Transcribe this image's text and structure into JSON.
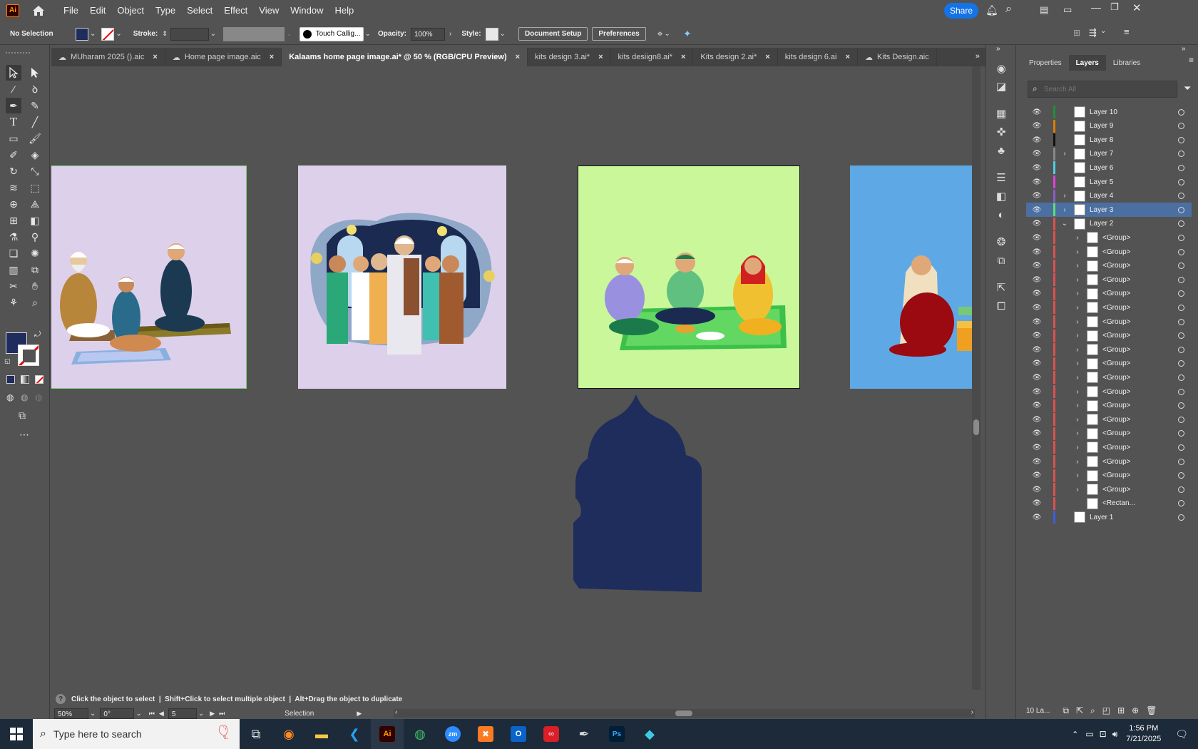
{
  "menubar": {
    "app_icon": "Ai",
    "items": [
      "File",
      "Edit",
      "Object",
      "Type",
      "Select",
      "Effect",
      "View",
      "Window",
      "Help"
    ],
    "share": "Share"
  },
  "control": {
    "selection": "No Selection",
    "stroke_label": "Stroke:",
    "brush": "Touch Callig...",
    "opacity_label": "Opacity:",
    "opacity": "100%",
    "style_label": "Style:",
    "doc_setup": "Document Setup",
    "preferences": "Preferences"
  },
  "tabs": [
    {
      "label": "MUharam 2025 ().aic",
      "close": "×",
      "cloud": true
    },
    {
      "label": "Home page image.aic",
      "close": "×",
      "cloud": true
    },
    {
      "label": "Kalaams home page image.ai* @ 50 % (RGB/CPU Preview)",
      "close": "×",
      "cloud": false
    },
    {
      "label": "kits design 3.ai*",
      "close": "×",
      "cloud": false
    },
    {
      "label": "kits desiign8.ai*",
      "close": "×",
      "cloud": false
    },
    {
      "label": "Kits design 2.ai*",
      "close": "×",
      "cloud": false
    },
    {
      "label": "kits design 6.ai",
      "close": "×",
      "cloud": false
    },
    {
      "label": "Kits Design.aic",
      "close": "",
      "cloud": true
    }
  ],
  "panel": {
    "tabs": [
      "Properties",
      "Layers",
      "Libraries"
    ],
    "search_placeholder": "Search All",
    "layers": [
      {
        "name": "Layer 10",
        "color": "#1f8f3a",
        "arrow": "",
        "indent": 0
      },
      {
        "name": "Layer 9",
        "color": "#e07b00",
        "arrow": "",
        "indent": 0
      },
      {
        "name": "Layer 8",
        "color": "#111111",
        "arrow": "",
        "indent": 0
      },
      {
        "name": "Layer 7",
        "color": "#888888",
        "arrow": "›",
        "indent": 0
      },
      {
        "name": "Layer 6",
        "color": "#4fd0e0",
        "arrow": "",
        "indent": 0
      },
      {
        "name": "Layer 5",
        "color": "#e040e0",
        "arrow": "",
        "indent": 0
      },
      {
        "name": "Layer 4",
        "color": "#8a5cc8",
        "arrow": "›",
        "indent": 0
      },
      {
        "name": "Layer 3",
        "color": "#5ee070",
        "arrow": "›",
        "indent": 0
      },
      {
        "name": "Layer 2",
        "color": "#e05050",
        "arrow": "⌄",
        "indent": 0
      },
      {
        "name": "<Group>",
        "color": "#e05050",
        "arrow": "›",
        "indent": 1
      },
      {
        "name": "<Group>",
        "color": "#e05050",
        "arrow": "›",
        "indent": 1
      },
      {
        "name": "<Group>",
        "color": "#e05050",
        "arrow": "›",
        "indent": 1
      },
      {
        "name": "<Group>",
        "color": "#e05050",
        "arrow": "›",
        "indent": 1
      },
      {
        "name": "<Group>",
        "color": "#e05050",
        "arrow": "›",
        "indent": 1
      },
      {
        "name": "<Group>",
        "color": "#e05050",
        "arrow": "›",
        "indent": 1
      },
      {
        "name": "<Group>",
        "color": "#e05050",
        "arrow": "›",
        "indent": 1
      },
      {
        "name": "<Group>",
        "color": "#e05050",
        "arrow": "›",
        "indent": 1
      },
      {
        "name": "<Group>",
        "color": "#e05050",
        "arrow": "›",
        "indent": 1
      },
      {
        "name": "<Group>",
        "color": "#e05050",
        "arrow": "›",
        "indent": 1
      },
      {
        "name": "<Group>",
        "color": "#e05050",
        "arrow": "›",
        "indent": 1
      },
      {
        "name": "<Group>",
        "color": "#e05050",
        "arrow": "›",
        "indent": 1
      },
      {
        "name": "<Group>",
        "color": "#e05050",
        "arrow": "›",
        "indent": 1
      },
      {
        "name": "<Group>",
        "color": "#e05050",
        "arrow": "›",
        "indent": 1
      },
      {
        "name": "<Group>",
        "color": "#e05050",
        "arrow": "›",
        "indent": 1
      },
      {
        "name": "<Group>",
        "color": "#e05050",
        "arrow": "›",
        "indent": 1
      },
      {
        "name": "<Group>",
        "color": "#e05050",
        "arrow": "›",
        "indent": 1
      },
      {
        "name": "<Group>",
        "color": "#e05050",
        "arrow": "›",
        "indent": 1
      },
      {
        "name": "<Group>",
        "color": "#e05050",
        "arrow": "›",
        "indent": 1
      },
      {
        "name": "<Rectan...",
        "color": "#e05050",
        "arrow": "",
        "indent": 1
      },
      {
        "name": "Layer 1",
        "color": "#3a60e0",
        "arrow": "",
        "indent": 0
      }
    ],
    "footer_count": "10 La..."
  },
  "status": {
    "hint": "Click the object to select  |  Shift+Click to select multiple object  |  Alt+Drag the object to duplicate",
    "zoom": "50%",
    "rotation": "0°",
    "artboard": "5",
    "tool": "Selection"
  },
  "taskbar": {
    "search": "Type here to search",
    "time": "1:56 PM",
    "date": "7/21/2025"
  },
  "colors": {
    "fill": "#1f2d5c",
    "artboard1": "#ddd0ea",
    "artboard2": "#ddd0ea",
    "artboard3": "#c9f79a",
    "artboard4": "#5fa8e6",
    "dome": "#1f2d5c"
  }
}
